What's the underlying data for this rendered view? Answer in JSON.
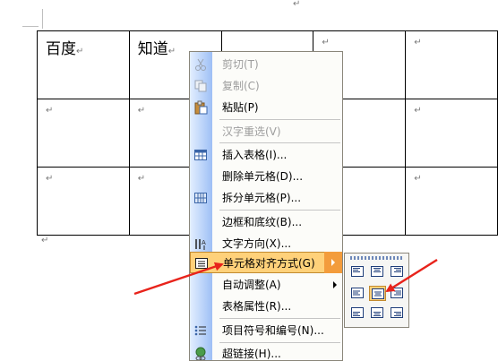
{
  "table": {
    "rows": [
      [
        "百度",
        "知道",
        "",
        "",
        ""
      ],
      [
        "",
        "",
        "",
        "",
        ""
      ],
      [
        "",
        "",
        "",
        "",
        ""
      ]
    ],
    "paragraph_mark": "↵"
  },
  "context_menu": {
    "items": [
      {
        "label": "剪切(T)",
        "icon": "scissors-icon",
        "enabled": false
      },
      {
        "label": "复制(C)",
        "icon": "copy-icon",
        "enabled": false
      },
      {
        "label": "粘贴(P)",
        "icon": "paste-icon",
        "enabled": true
      },
      {
        "label": "汉字重选(V)",
        "icon": "",
        "enabled": false
      },
      {
        "label": "插入表格(I)...",
        "icon": "insert-table-icon",
        "enabled": true
      },
      {
        "label": "删除单元格(D)...",
        "icon": "",
        "enabled": true
      },
      {
        "label": "拆分单元格(P)...",
        "icon": "split-cells-icon",
        "enabled": true
      },
      {
        "label": "边框和底纹(B)...",
        "icon": "",
        "enabled": true
      },
      {
        "label": "文字方向(X)...",
        "icon": "text-direction-icon",
        "enabled": true
      },
      {
        "label": "单元格对齐方式(G)",
        "icon": "cell-alignment-icon",
        "enabled": true,
        "selected": true,
        "submenu": true
      },
      {
        "label": "自动调整(A)",
        "icon": "",
        "enabled": true,
        "submenu": true
      },
      {
        "label": "表格属性(R)...",
        "icon": "",
        "enabled": true
      },
      {
        "label": "项目符号和编号(N)...",
        "icon": "bullets-numbering-icon",
        "enabled": true
      },
      {
        "label": "超链接(H)...",
        "icon": "hyperlink-icon",
        "enabled": true
      }
    ]
  },
  "alignment_submenu": {
    "options": [
      {
        "name": "top-left",
        "highlighted": false
      },
      {
        "name": "top-center",
        "highlighted": false
      },
      {
        "name": "top-right",
        "highlighted": false
      },
      {
        "name": "middle-left",
        "highlighted": false
      },
      {
        "name": "middle-center",
        "highlighted": true
      },
      {
        "name": "middle-right",
        "highlighted": false
      },
      {
        "name": "bottom-left",
        "highlighted": false
      },
      {
        "name": "bottom-center",
        "highlighted": false
      },
      {
        "name": "bottom-right",
        "highlighted": false
      }
    ]
  },
  "colors": {
    "highlight": "#ffd17a",
    "submenu_arrow_bg": "#f39c3c",
    "annotation_arrow": "#e8231b",
    "menu_gradient_start": "#e3efff",
    "menu_gradient_end": "#9ebff5"
  }
}
